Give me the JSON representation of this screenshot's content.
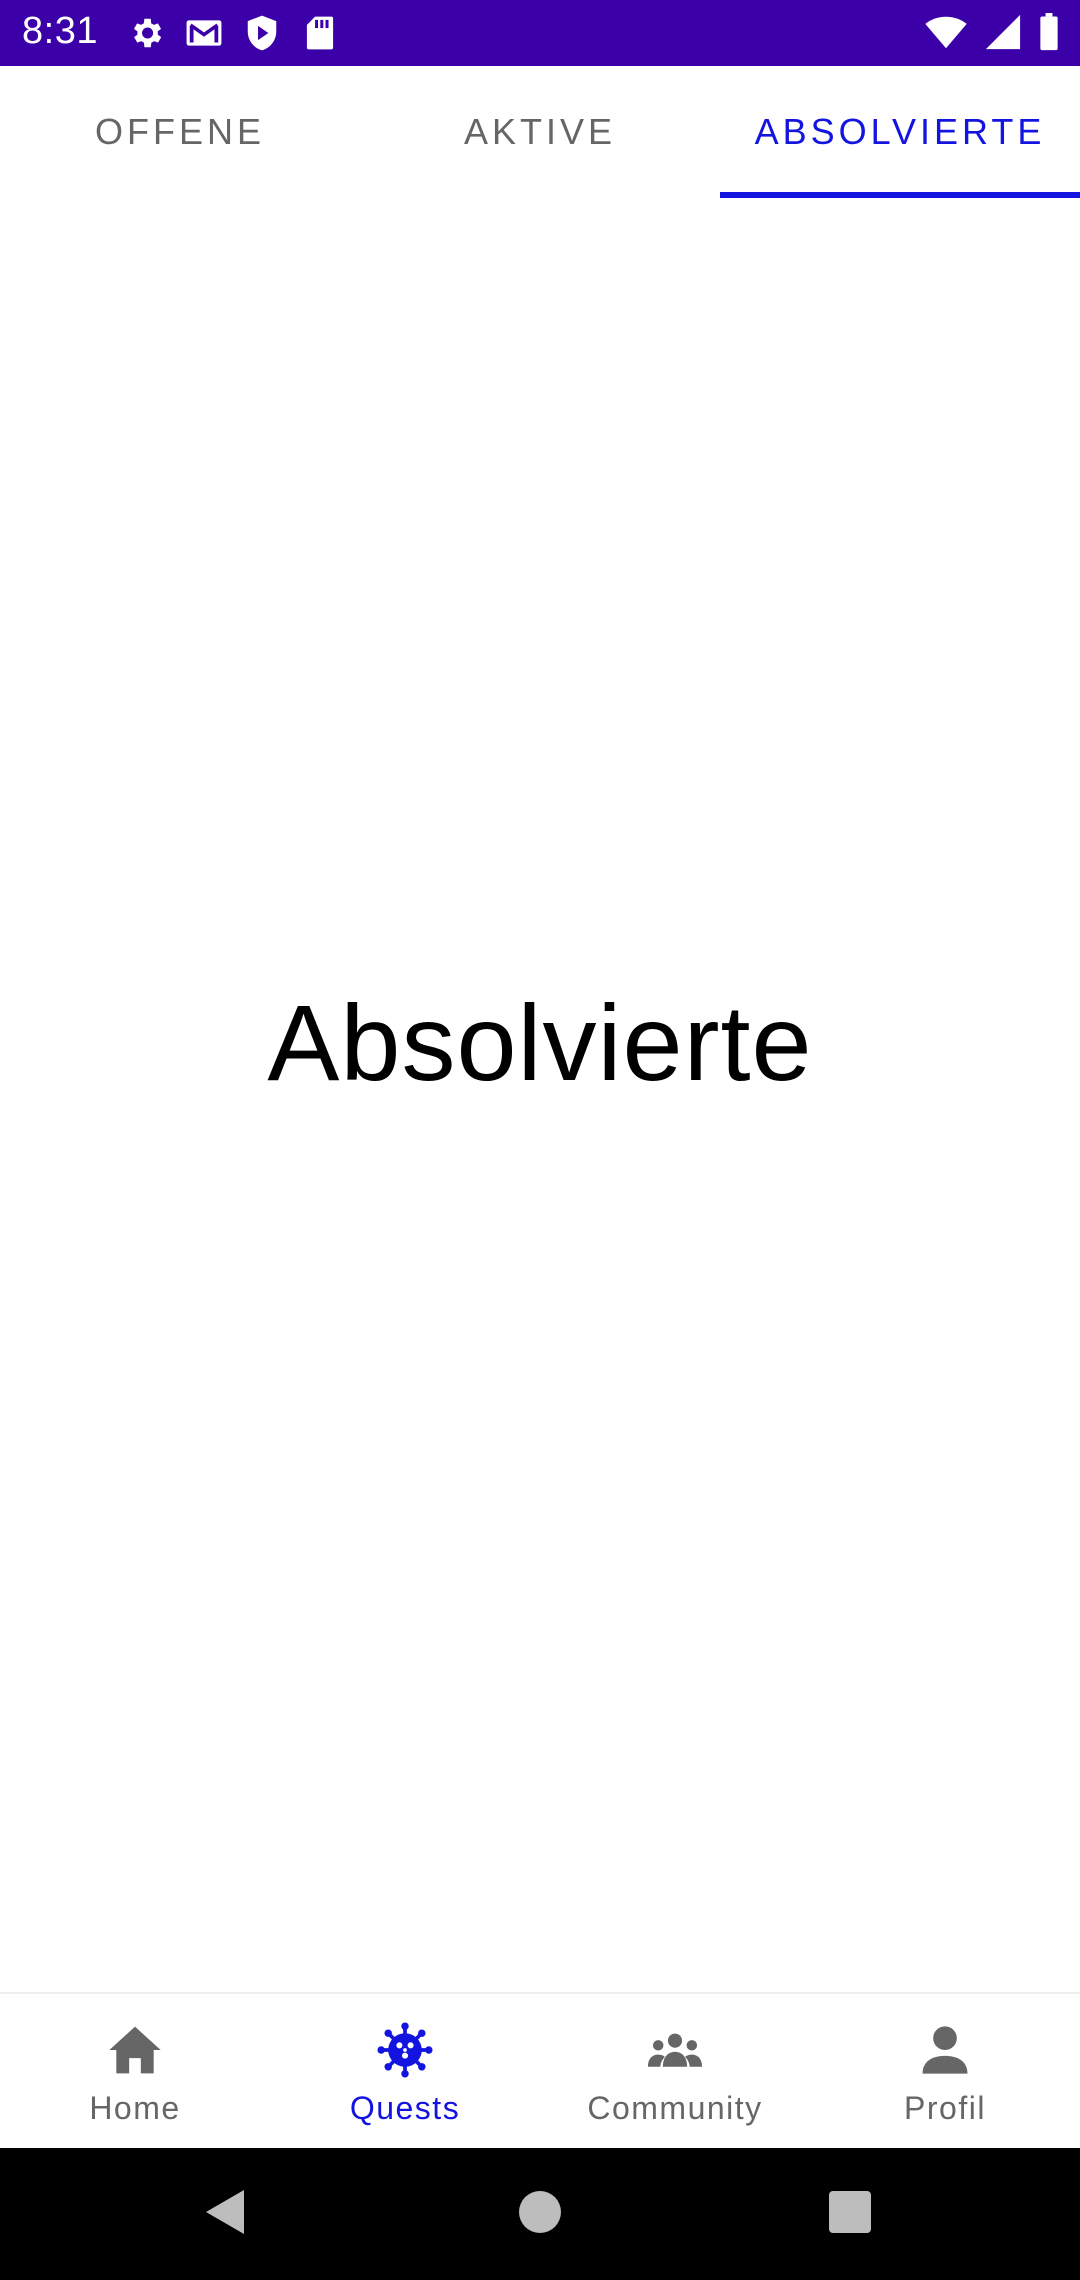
{
  "status_bar": {
    "time": "8:31",
    "left_icons": [
      "settings-icon",
      "gmail-icon",
      "shield-play-icon",
      "sd-card-icon"
    ],
    "right_icons": [
      "wifi-icon",
      "cell-signal-icon",
      "battery-icon"
    ],
    "background": "#3c00a8"
  },
  "tabs": [
    {
      "label": "OFFENE",
      "active": false
    },
    {
      "label": "AKTIVE",
      "active": false
    },
    {
      "label": "ABSOLVIERTE",
      "active": true
    }
  ],
  "content": {
    "title": "Absolvierte"
  },
  "bottom_nav": [
    {
      "label": "Home",
      "icon": "home-icon",
      "active": false
    },
    {
      "label": "Quests",
      "icon": "virus-icon",
      "active": true
    },
    {
      "label": "Community",
      "icon": "group-icon",
      "active": false
    },
    {
      "label": "Profil",
      "icon": "person-icon",
      "active": false
    }
  ],
  "system_nav": [
    "back-icon",
    "home-circle-icon",
    "recents-icon"
  ],
  "colors": {
    "accent": "#1414e0",
    "inactive": "#666666"
  }
}
